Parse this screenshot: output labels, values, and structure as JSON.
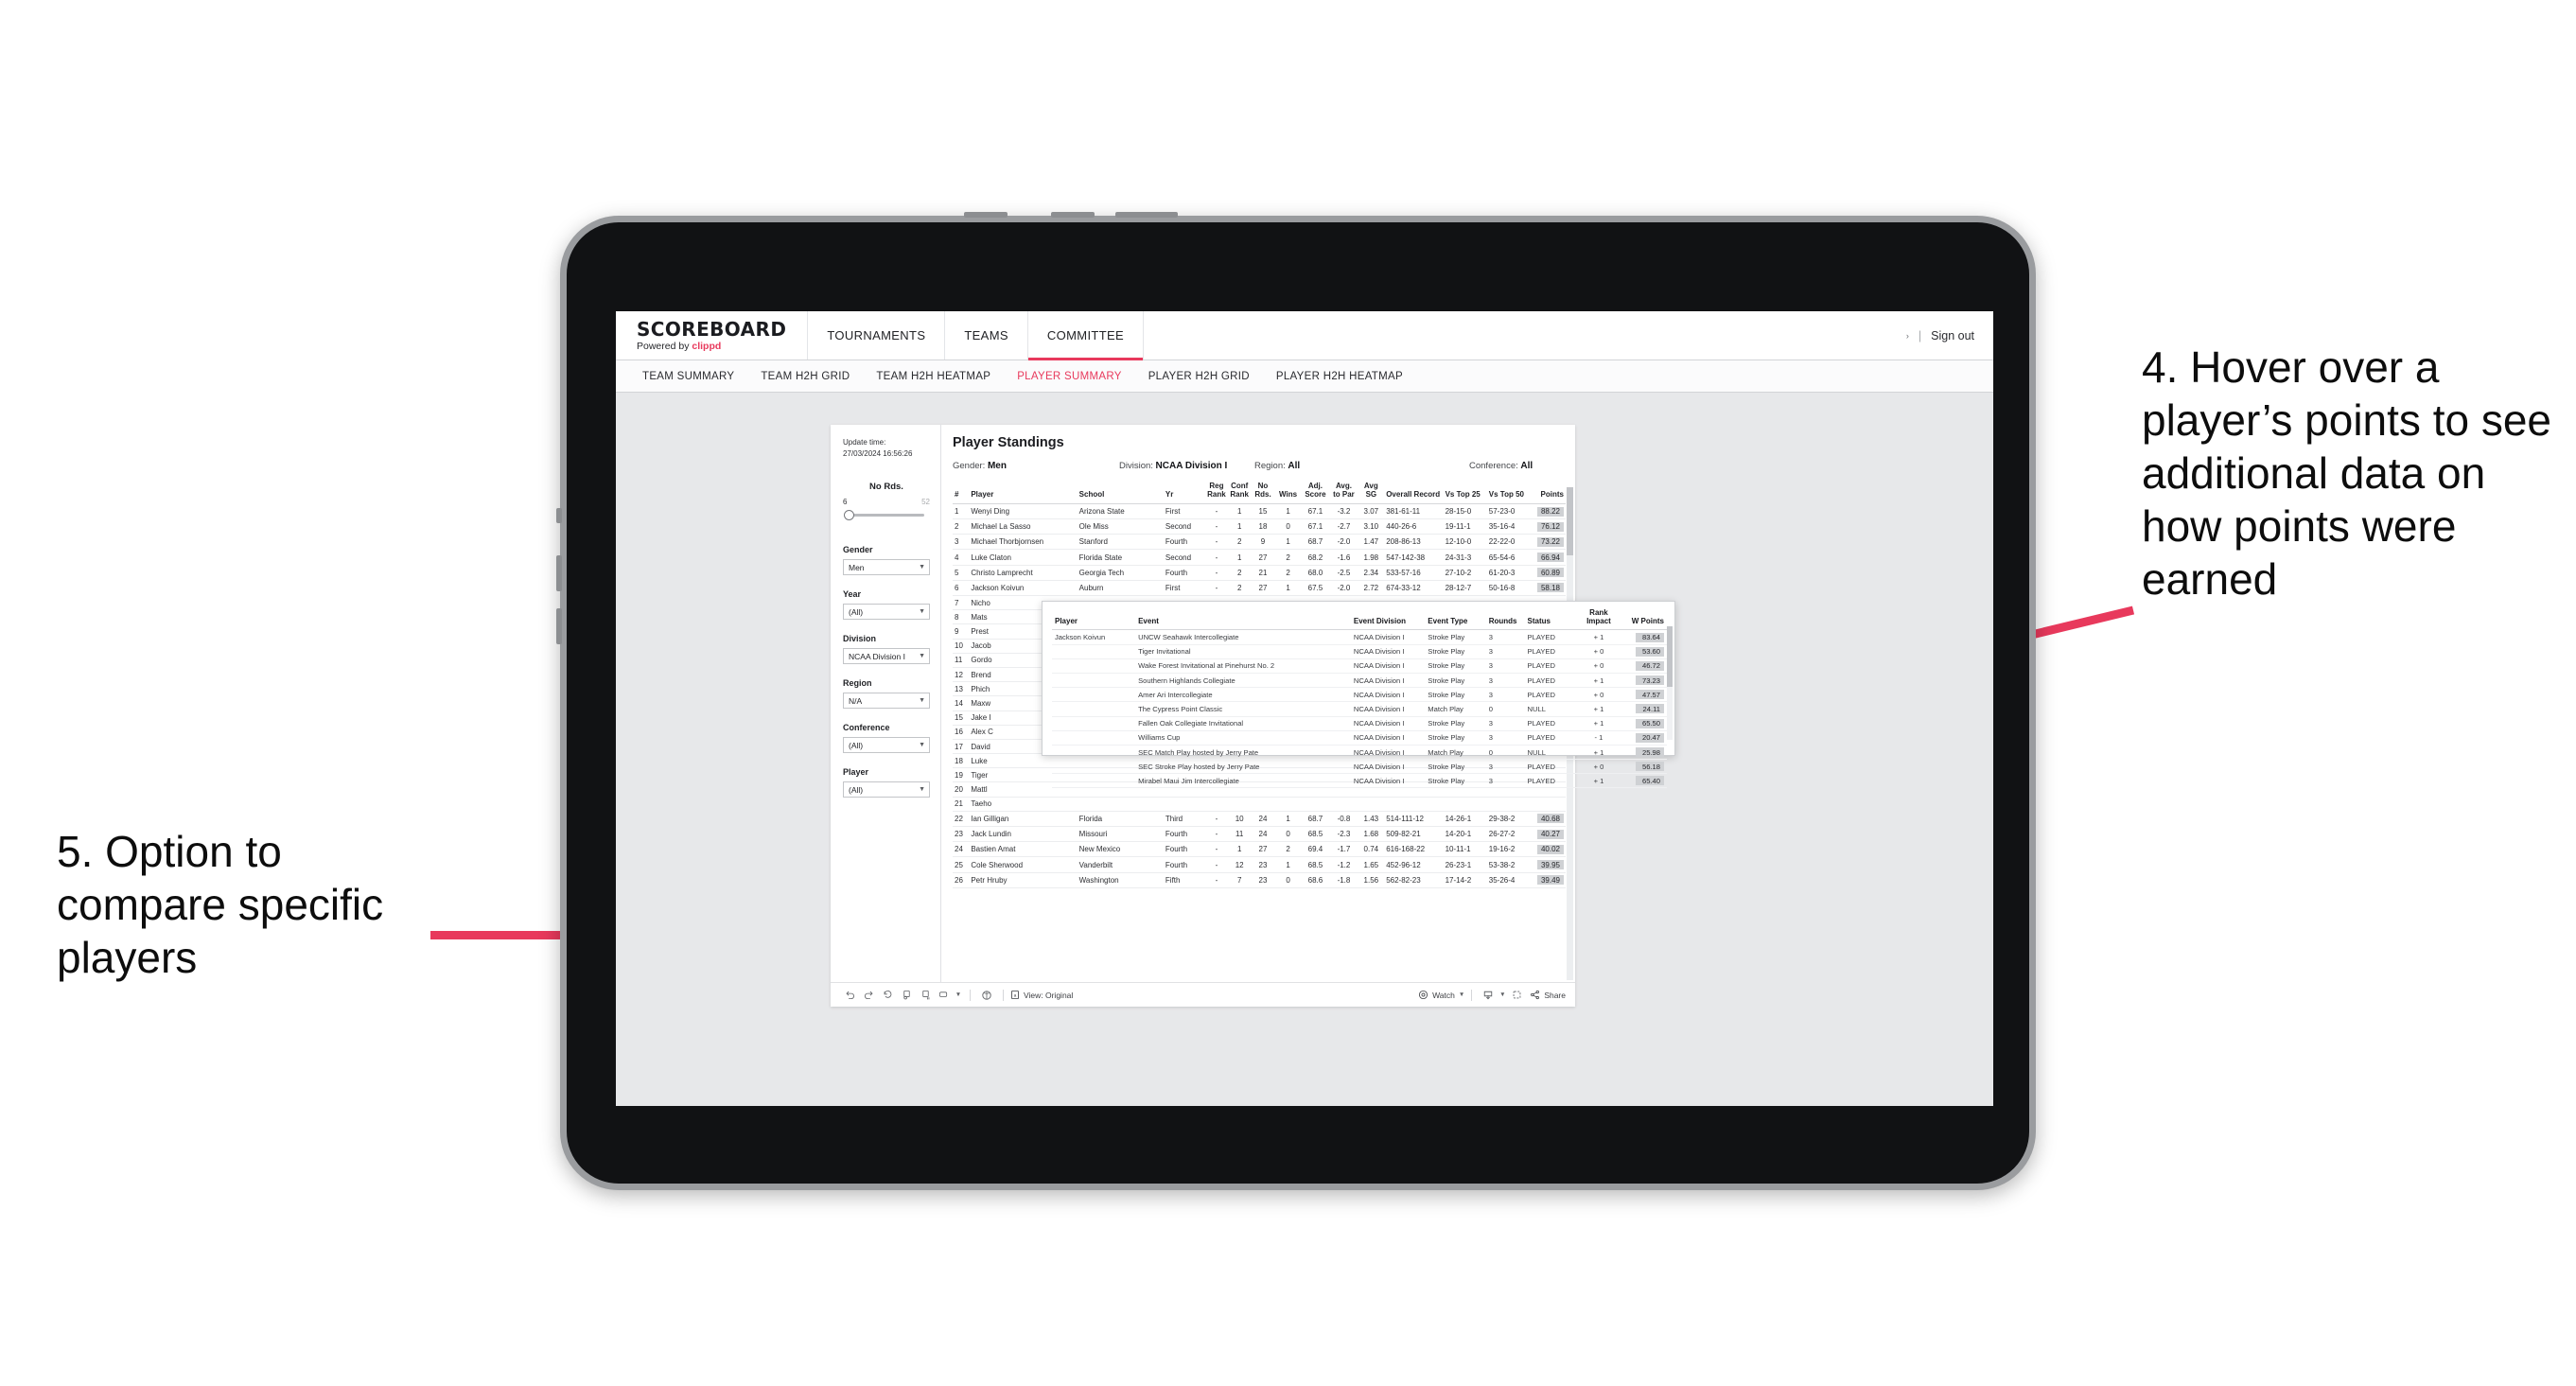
{
  "annotations": {
    "right": "4. Hover over a player’s points to see additional data on how points were earned",
    "left": "5. Option to compare specific players",
    "accent": "#E8395C"
  },
  "app": {
    "brand": {
      "title": "SCOREBOARD",
      "powered_prefix": "Powered by",
      "powered_name": "clippd"
    },
    "nav": [
      {
        "label": "TOURNAMENTS",
        "active": false
      },
      {
        "label": "TEAMS",
        "active": false
      },
      {
        "label": "COMMITTEE",
        "active": true
      }
    ],
    "nav_right": {
      "caret": "›",
      "divider": "|",
      "signout": "Sign out"
    },
    "subtabs": [
      {
        "label": "TEAM SUMMARY",
        "active": false
      },
      {
        "label": "TEAM H2H GRID",
        "active": false
      },
      {
        "label": "TEAM H2H HEATMAP",
        "active": false
      },
      {
        "label": "PLAYER SUMMARY",
        "active": true
      },
      {
        "label": "PLAYER H2H GRID",
        "active": false
      },
      {
        "label": "PLAYER H2H HEATMAP",
        "active": false
      }
    ]
  },
  "filters": {
    "update_label": "Update time:",
    "update_value": "27/03/2024 16:56:26",
    "slider": {
      "label": "No Rds.",
      "min": "6",
      "max": "52"
    },
    "selects": [
      {
        "label": "Gender",
        "value": "Men"
      },
      {
        "label": "Year",
        "value": "(All)"
      },
      {
        "label": "Division",
        "value": "NCAA Division I"
      },
      {
        "label": "Region",
        "value": "N/A"
      },
      {
        "label": "Conference",
        "value": "(All)"
      },
      {
        "label": "Player",
        "value": "(All)"
      }
    ]
  },
  "standings": {
    "title": "Player Standings",
    "meta": [
      {
        "label": "Gender:",
        "value": "Men"
      },
      {
        "label": "Division:",
        "value": "NCAA Division I"
      },
      {
        "label": "Region:",
        "value": "All"
      },
      {
        "label": "Conference:",
        "value": "All"
      }
    ],
    "columns": [
      "#",
      "Player",
      "School",
      "Yr",
      "Reg Rank",
      "Conf Rank",
      "No Rds.",
      "Wins",
      "Adj. Score",
      "Avg. to Par",
      "Avg SG",
      "Overall Record",
      "Vs Top 25",
      "Vs Top 50",
      "Points"
    ],
    "rows": [
      {
        "n": "1",
        "player": "Wenyi Ding",
        "school": "Arizona State",
        "yr": "First",
        "reg": "-",
        "conf": "1",
        "rds": "15",
        "wins": "1",
        "adj": "67.1",
        "par": "-3.2",
        "sg": "3.07",
        "rec": "381-61-11",
        "t25": "28-15-0",
        "t50": "57-23-0",
        "pts": "88.22"
      },
      {
        "n": "2",
        "player": "Michael La Sasso",
        "school": "Ole Miss",
        "yr": "Second",
        "reg": "-",
        "conf": "1",
        "rds": "18",
        "wins": "0",
        "adj": "67.1",
        "par": "-2.7",
        "sg": "3.10",
        "rec": "440-26-6",
        "t25": "19-11-1",
        "t50": "35-16-4",
        "pts": "76.12"
      },
      {
        "n": "3",
        "player": "Michael Thorbjornsen",
        "school": "Stanford",
        "yr": "Fourth",
        "reg": "-",
        "conf": "2",
        "rds": "9",
        "wins": "1",
        "adj": "68.7",
        "par": "-2.0",
        "sg": "1.47",
        "rec": "208-86-13",
        "t25": "12-10-0",
        "t50": "22-22-0",
        "pts": "73.22"
      },
      {
        "n": "4",
        "player": "Luke Claton",
        "school": "Florida State",
        "yr": "Second",
        "reg": "-",
        "conf": "1",
        "rds": "27",
        "wins": "2",
        "adj": "68.2",
        "par": "-1.6",
        "sg": "1.98",
        "rec": "547-142-38",
        "t25": "24-31-3",
        "t50": "65-54-6",
        "pts": "66.94"
      },
      {
        "n": "5",
        "player": "Christo Lamprecht",
        "school": "Georgia Tech",
        "yr": "Fourth",
        "reg": "-",
        "conf": "2",
        "rds": "21",
        "wins": "2",
        "adj": "68.0",
        "par": "-2.5",
        "sg": "2.34",
        "rec": "533-57-16",
        "t25": "27-10-2",
        "t50": "61-20-3",
        "pts": "60.89"
      },
      {
        "n": "6",
        "player": "Jackson Koivun",
        "school": "Auburn",
        "yr": "First",
        "reg": "-",
        "conf": "2",
        "rds": "27",
        "wins": "1",
        "adj": "67.5",
        "par": "-2.0",
        "sg": "2.72",
        "rec": "674-33-12",
        "t25": "28-12-7",
        "t50": "50-16-8",
        "pts": "58.18"
      },
      {
        "n": "7",
        "player": "Nicho",
        "school": "",
        "yr": "",
        "reg": "",
        "conf": "",
        "rds": "",
        "wins": "",
        "adj": "",
        "par": "",
        "sg": "",
        "rec": "",
        "t25": "",
        "t50": "",
        "pts": ""
      },
      {
        "n": "8",
        "player": "Mats",
        "school": "",
        "yr": "",
        "reg": "",
        "conf": "",
        "rds": "",
        "wins": "",
        "adj": "",
        "par": "",
        "sg": "",
        "rec": "",
        "t25": "",
        "t50": "",
        "pts": ""
      },
      {
        "n": "9",
        "player": "Prest",
        "school": "",
        "yr": "",
        "reg": "",
        "conf": "",
        "rds": "",
        "wins": "",
        "adj": "",
        "par": "",
        "sg": "",
        "rec": "",
        "t25": "",
        "t50": "",
        "pts": ""
      },
      {
        "n": "10",
        "player": "Jacob",
        "school": "",
        "yr": "",
        "reg": "",
        "conf": "",
        "rds": "",
        "wins": "",
        "adj": "",
        "par": "",
        "sg": "",
        "rec": "",
        "t25": "",
        "t50": "",
        "pts": ""
      },
      {
        "n": "11",
        "player": "Gordo",
        "school": "",
        "yr": "",
        "reg": "",
        "conf": "",
        "rds": "",
        "wins": "",
        "adj": "",
        "par": "",
        "sg": "",
        "rec": "",
        "t25": "",
        "t50": "",
        "pts": ""
      },
      {
        "n": "12",
        "player": "Brend",
        "school": "",
        "yr": "",
        "reg": "",
        "conf": "",
        "rds": "",
        "wins": "",
        "adj": "",
        "par": "",
        "sg": "",
        "rec": "",
        "t25": "",
        "t50": "",
        "pts": ""
      },
      {
        "n": "13",
        "player": "Phich",
        "school": "",
        "yr": "",
        "reg": "",
        "conf": "",
        "rds": "",
        "wins": "",
        "adj": "",
        "par": "",
        "sg": "",
        "rec": "",
        "t25": "",
        "t50": "",
        "pts": ""
      },
      {
        "n": "14",
        "player": "Maxw",
        "school": "",
        "yr": "",
        "reg": "",
        "conf": "",
        "rds": "",
        "wins": "",
        "adj": "",
        "par": "",
        "sg": "",
        "rec": "",
        "t25": "",
        "t50": "",
        "pts": ""
      },
      {
        "n": "15",
        "player": "Jake I",
        "school": "",
        "yr": "",
        "reg": "",
        "conf": "",
        "rds": "",
        "wins": "",
        "adj": "",
        "par": "",
        "sg": "",
        "rec": "",
        "t25": "",
        "t50": "",
        "pts": ""
      },
      {
        "n": "16",
        "player": "Alex C",
        "school": "",
        "yr": "",
        "reg": "",
        "conf": "",
        "rds": "",
        "wins": "",
        "adj": "",
        "par": "",
        "sg": "",
        "rec": "",
        "t25": "",
        "t50": "",
        "pts": ""
      },
      {
        "n": "17",
        "player": "David",
        "school": "",
        "yr": "",
        "reg": "",
        "conf": "",
        "rds": "",
        "wins": "",
        "adj": "",
        "par": "",
        "sg": "",
        "rec": "",
        "t25": "",
        "t50": "",
        "pts": ""
      },
      {
        "n": "18",
        "player": "Luke",
        "school": "",
        "yr": "",
        "reg": "",
        "conf": "",
        "rds": "",
        "wins": "",
        "adj": "",
        "par": "",
        "sg": "",
        "rec": "",
        "t25": "",
        "t50": "",
        "pts": ""
      },
      {
        "n": "19",
        "player": "Tiger",
        "school": "",
        "yr": "",
        "reg": "",
        "conf": "",
        "rds": "",
        "wins": "",
        "adj": "",
        "par": "",
        "sg": "",
        "rec": "",
        "t25": "",
        "t50": "",
        "pts": ""
      },
      {
        "n": "20",
        "player": "Mattl",
        "school": "",
        "yr": "",
        "reg": "",
        "conf": "",
        "rds": "",
        "wins": "",
        "adj": "",
        "par": "",
        "sg": "",
        "rec": "",
        "t25": "",
        "t50": "",
        "pts": ""
      },
      {
        "n": "21",
        "player": "Taeho",
        "school": "",
        "yr": "",
        "reg": "",
        "conf": "",
        "rds": "",
        "wins": "",
        "adj": "",
        "par": "",
        "sg": "",
        "rec": "",
        "t25": "",
        "t50": "",
        "pts": ""
      },
      {
        "n": "22",
        "player": "Ian Gilligan",
        "school": "Florida",
        "yr": "Third",
        "reg": "-",
        "conf": "10",
        "rds": "24",
        "wins": "1",
        "adj": "68.7",
        "par": "-0.8",
        "sg": "1.43",
        "rec": "514-111-12",
        "t25": "14-26-1",
        "t50": "29-38-2",
        "pts": "40.68"
      },
      {
        "n": "23",
        "player": "Jack Lundin",
        "school": "Missouri",
        "yr": "Fourth",
        "reg": "-",
        "conf": "11",
        "rds": "24",
        "wins": "0",
        "adj": "68.5",
        "par": "-2.3",
        "sg": "1.68",
        "rec": "509-82-21",
        "t25": "14-20-1",
        "t50": "26-27-2",
        "pts": "40.27"
      },
      {
        "n": "24",
        "player": "Bastien Amat",
        "school": "New Mexico",
        "yr": "Fourth",
        "reg": "-",
        "conf": "1",
        "rds": "27",
        "wins": "2",
        "adj": "69.4",
        "par": "-1.7",
        "sg": "0.74",
        "rec": "616-168-22",
        "t25": "10-11-1",
        "t50": "19-16-2",
        "pts": "40.02"
      },
      {
        "n": "25",
        "player": "Cole Sherwood",
        "school": "Vanderbilt",
        "yr": "Fourth",
        "reg": "-",
        "conf": "12",
        "rds": "23",
        "wins": "1",
        "adj": "68.5",
        "par": "-1.2",
        "sg": "1.65",
        "rec": "452-96-12",
        "t25": "26-23-1",
        "t50": "53-38-2",
        "pts": "39.95"
      },
      {
        "n": "26",
        "player": "Petr Hruby",
        "school": "Washington",
        "yr": "Fifth",
        "reg": "-",
        "conf": "7",
        "rds": "23",
        "wins": "0",
        "adj": "68.6",
        "par": "-1.8",
        "sg": "1.56",
        "rec": "562-82-23",
        "t25": "17-14-2",
        "t50": "35-26-4",
        "pts": "39.49"
      }
    ]
  },
  "tooltip": {
    "columns": [
      "Player",
      "Event",
      "Event Division",
      "Event Type",
      "Rounds",
      "Status",
      "Rank Impact",
      "W Points"
    ],
    "player": "Jackson Koivun",
    "rows": [
      {
        "event": "UNCW Seahawk Intercollegiate",
        "div": "NCAA Division I",
        "type": "Stroke Play",
        "rounds": "3",
        "status": "PLAYED",
        "rank": "+ 1",
        "pts": "83.64"
      },
      {
        "event": "Tiger Invitational",
        "div": "NCAA Division I",
        "type": "Stroke Play",
        "rounds": "3",
        "status": "PLAYED",
        "rank": "+ 0",
        "pts": "53.60"
      },
      {
        "event": "Wake Forest Invitational at Pinehurst No. 2",
        "div": "NCAA Division I",
        "type": "Stroke Play",
        "rounds": "3",
        "status": "PLAYED",
        "rank": "+ 0",
        "pts": "46.72"
      },
      {
        "event": "Southern Highlands Collegiate",
        "div": "NCAA Division I",
        "type": "Stroke Play",
        "rounds": "3",
        "status": "PLAYED",
        "rank": "+ 1",
        "pts": "73.23"
      },
      {
        "event": "Amer Ari Intercollegiate",
        "div": "NCAA Division I",
        "type": "Stroke Play",
        "rounds": "3",
        "status": "PLAYED",
        "rank": "+ 0",
        "pts": "47.57"
      },
      {
        "event": "The Cypress Point Classic",
        "div": "NCAA Division I",
        "type": "Match Play",
        "rounds": "0",
        "status": "NULL",
        "rank": "+ 1",
        "pts": "24.11"
      },
      {
        "event": "Fallen Oak Collegiate Invitational",
        "div": "NCAA Division I",
        "type": "Stroke Play",
        "rounds": "3",
        "status": "PLAYED",
        "rank": "+ 1",
        "pts": "65.50"
      },
      {
        "event": "Williams Cup",
        "div": "NCAA Division I",
        "type": "Stroke Play",
        "rounds": "3",
        "status": "PLAYED",
        "rank": "- 1",
        "pts": "20.47"
      },
      {
        "event": "SEC Match Play hosted by Jerry Pate",
        "div": "NCAA Division I",
        "type": "Match Play",
        "rounds": "0",
        "status": "NULL",
        "rank": "+ 1",
        "pts": "25.98"
      },
      {
        "event": "SEC Stroke Play hosted by Jerry Pate",
        "div": "NCAA Division I",
        "type": "Stroke Play",
        "rounds": "3",
        "status": "PLAYED",
        "rank": "+ 0",
        "pts": "56.18"
      },
      {
        "event": "Mirabel Maui Jim Intercollegiate",
        "div": "NCAA Division I",
        "type": "Stroke Play",
        "rounds": "3",
        "status": "PLAYED",
        "rank": "+ 1",
        "pts": "65.40"
      }
    ]
  },
  "toolbar": {
    "view_label": "View: Original",
    "watch_label": "Watch",
    "share_label": "Share"
  }
}
